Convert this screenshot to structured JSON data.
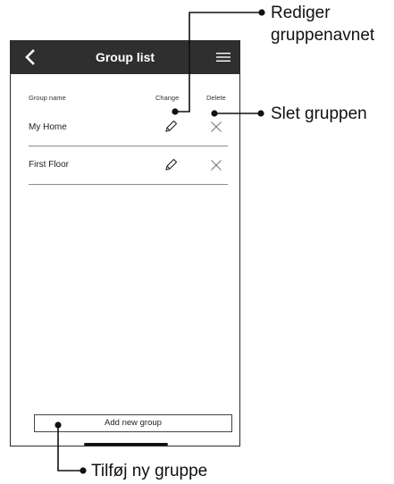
{
  "header": {
    "title": "Group list"
  },
  "columns": {
    "name": "Group name",
    "change": "Change",
    "delete": "Delete"
  },
  "groups": [
    {
      "name": "My Home"
    },
    {
      "name": "First Floor"
    }
  ],
  "footer": {
    "add_label": "Add new group"
  },
  "callouts": {
    "rename_line1": "Rediger",
    "rename_line2": "gruppenavnet",
    "delete": "Slet gruppen",
    "add": "Tilføj ny gruppe"
  },
  "icons": {
    "back": "chevron-left-icon",
    "menu": "hamburger-menu-icon",
    "edit": "pencil-icon",
    "delete": "close-x-icon"
  },
  "colors": {
    "header_bg": "#2f2f2f",
    "header_text": "#ffffff"
  }
}
